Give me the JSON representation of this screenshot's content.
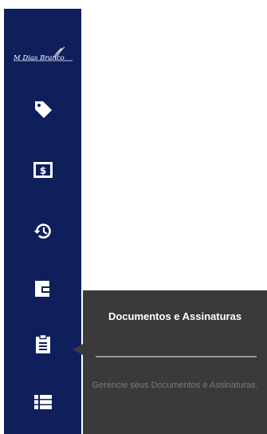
{
  "app": {
    "logo_text": "M Dias Branco",
    "brand_color": "#0f1f5c"
  },
  "sidebar": {
    "items": [
      {
        "icon": "tag-icon"
      },
      {
        "icon": "dollar-bill-icon"
      },
      {
        "icon": "history-icon"
      },
      {
        "icon": "wallet-icon"
      },
      {
        "icon": "clipboard-icon",
        "active_tooltip": true
      },
      {
        "icon": "list-icon"
      }
    ]
  },
  "tooltip": {
    "title": "Documentos e Assinaturas",
    "description": "Gerencie seus Documentos e Assinaturas."
  }
}
